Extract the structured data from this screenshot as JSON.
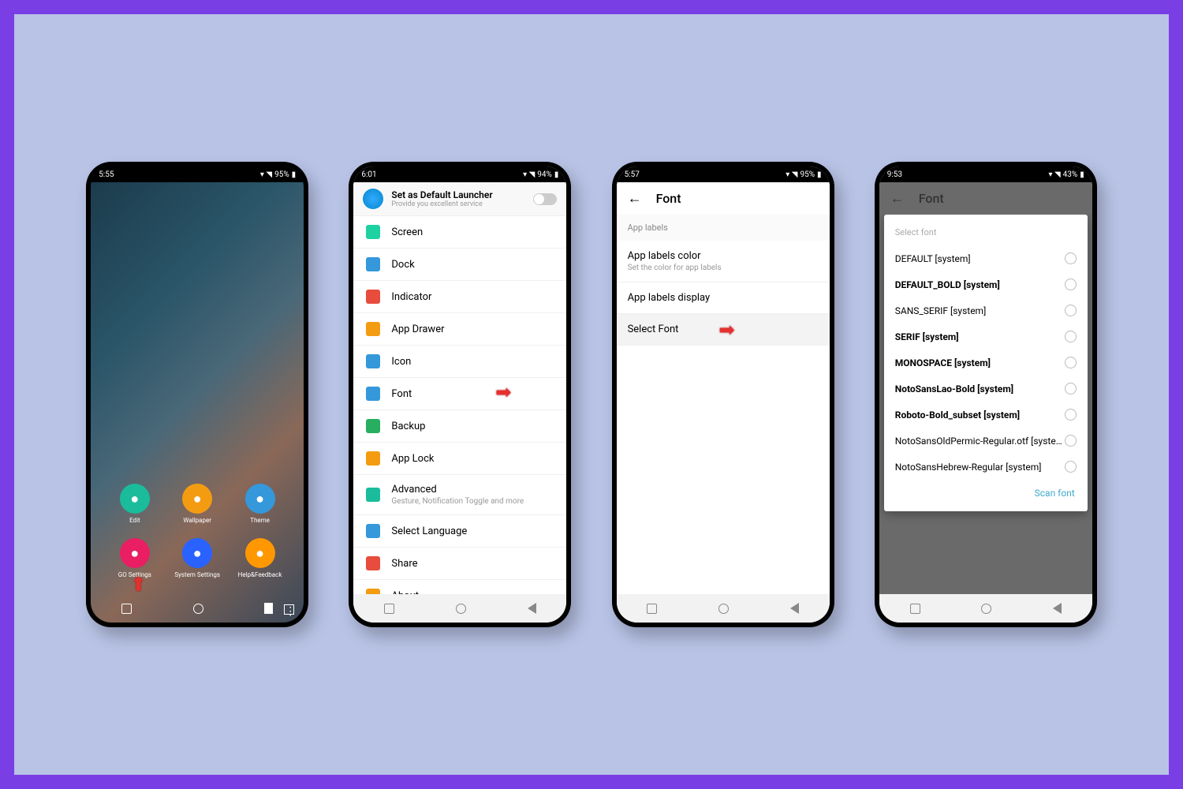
{
  "p1": {
    "time": "5:55",
    "bat": "95%",
    "apps": [
      {
        "l": "Edit",
        "c": "#1abc9c"
      },
      {
        "l": "Wallpaper",
        "c": "#f39c12"
      },
      {
        "l": "Theme",
        "c": "#3498db"
      },
      {
        "l": "GO Settings",
        "c": "#e91e63"
      },
      {
        "l": "System Settings",
        "c": "#2962ff"
      },
      {
        "l": "Help&Feedback",
        "c": "#ff9800"
      }
    ]
  },
  "p2": {
    "time": "6:01",
    "bat": "94%",
    "bnr": {
      "t": "Set as Default Launcher",
      "s": "Provide you excellent service"
    },
    "rows": [
      {
        "l": "Screen",
        "c": "#1dd1a1"
      },
      {
        "l": "Dock",
        "c": "#3498db"
      },
      {
        "l": "Indicator",
        "c": "#e74c3c"
      },
      {
        "l": "App Drawer",
        "c": "#f39c12"
      },
      {
        "l": "Icon",
        "c": "#3498db"
      },
      {
        "l": "Font",
        "c": "#3498db",
        "arr": true
      },
      {
        "l": "Backup",
        "c": "#27ae60"
      },
      {
        "l": "App Lock",
        "c": "#f39c12"
      },
      {
        "l": "Advanced",
        "s": "Gesture, Notification Toggle and more",
        "c": "#1abc9c"
      },
      {
        "l": "Select Language",
        "c": "#3498db"
      },
      {
        "l": "Share",
        "c": "#e74c3c"
      },
      {
        "l": "About",
        "c": "#f39c12"
      }
    ]
  },
  "p3": {
    "time": "5:57",
    "bat": "95%",
    "title": "Font",
    "sec": "App labels",
    "items": [
      {
        "l": "App labels color",
        "s": "Set the color for app labels"
      },
      {
        "l": "App labels display"
      },
      {
        "l": "Select Font",
        "sel": true,
        "arr": true
      }
    ]
  },
  "p4": {
    "time": "9:53",
    "bat": "43%",
    "title": "Font",
    "dlg": "Select font",
    "scan": "Scan font",
    "opts": [
      {
        "l": "DEFAULT [system]"
      },
      {
        "l": "DEFAULT_BOLD [system]",
        "b": true
      },
      {
        "l": "SANS_SERIF [system]"
      },
      {
        "l": "SERIF [system]",
        "b": true
      },
      {
        "l": "MONOSPACE [system]",
        "b": true
      },
      {
        "l": "NotoSansLao-Bold [system]",
        "b": true
      },
      {
        "l": "Roboto-Bold_subset [system]",
        "b": true
      },
      {
        "l": "NotoSansOldPermic-Regular.otf [syste…"
      },
      {
        "l": "NotoSansHebrew-Regular [system]"
      }
    ]
  }
}
